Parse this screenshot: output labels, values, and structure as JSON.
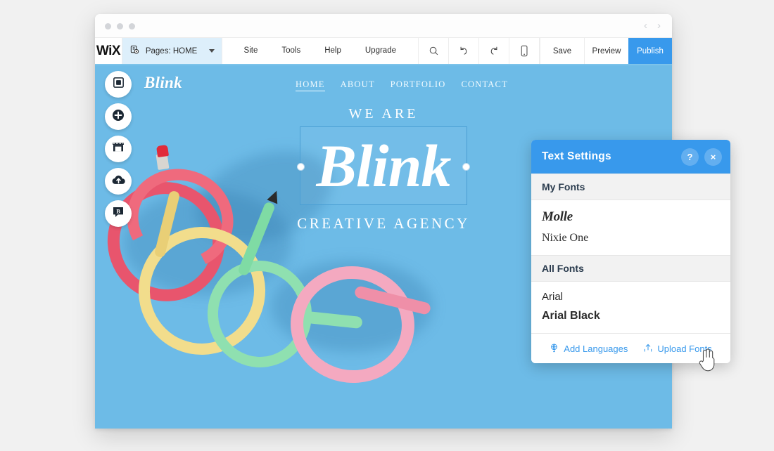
{
  "window": {
    "traffic_lights": [
      "dot-1",
      "dot-2",
      "dot-3"
    ],
    "nav_back": "‹",
    "nav_forward": "›"
  },
  "toolbar": {
    "logo": "WiX",
    "pages_icon": "pages-icon",
    "pages_label": "Pages: HOME",
    "menu": [
      {
        "label": "Site"
      },
      {
        "label": "Tools"
      },
      {
        "label": "Help"
      },
      {
        "label": "Upgrade"
      }
    ],
    "icons": [
      {
        "name": "search-icon"
      },
      {
        "name": "undo-icon"
      },
      {
        "name": "redo-icon"
      },
      {
        "name": "mobile-view-icon"
      }
    ],
    "save_label": "Save",
    "preview_label": "Preview",
    "publish_label": "Publish",
    "publish_color": "#3899ec",
    "accent_underline": "#7cc3ea"
  },
  "rail": {
    "items": [
      {
        "name": "background-icon",
        "label": "Background"
      },
      {
        "name": "add-icon",
        "label": "Add"
      },
      {
        "name": "store-icon",
        "label": "Store"
      },
      {
        "name": "app-market-icon",
        "label": "App Market"
      },
      {
        "name": "blog-icon",
        "label": "Blog"
      }
    ]
  },
  "site": {
    "background_color": "#6dbbe7",
    "brand": "Blink",
    "nav": [
      {
        "label": "HOME",
        "active": true
      },
      {
        "label": "ABOUT",
        "active": false
      },
      {
        "label": "PORTFOLIO",
        "active": false
      },
      {
        "label": "CONTACT",
        "active": false
      }
    ],
    "hero": {
      "eyebrow": "WE ARE",
      "headline": "Blink",
      "subline": "CREATIVE AGENCY",
      "selected": true
    }
  },
  "panel": {
    "title": "Text Settings",
    "help_label": "?",
    "close_label": "×",
    "header_color": "#3899ec",
    "sections": [
      {
        "heading": "My Fonts",
        "fonts": [
          {
            "label": "Molle",
            "style": "f-molle"
          },
          {
            "label": "Nixie One",
            "style": "f-nixie"
          }
        ]
      },
      {
        "heading": "All Fonts",
        "fonts": [
          {
            "label": "Arial",
            "style": "f-arial"
          },
          {
            "label": "Arial Black",
            "style": "f-arial-black"
          }
        ]
      }
    ],
    "footer": {
      "add_languages_icon": "globe-icon",
      "add_languages_label": "Add Languages",
      "upload_fonts_icon": "upload-icon",
      "upload_fonts_label": "Upload Fonts",
      "link_color": "#3899ec"
    }
  },
  "cursor": {
    "name": "hand-pointer-cursor"
  }
}
